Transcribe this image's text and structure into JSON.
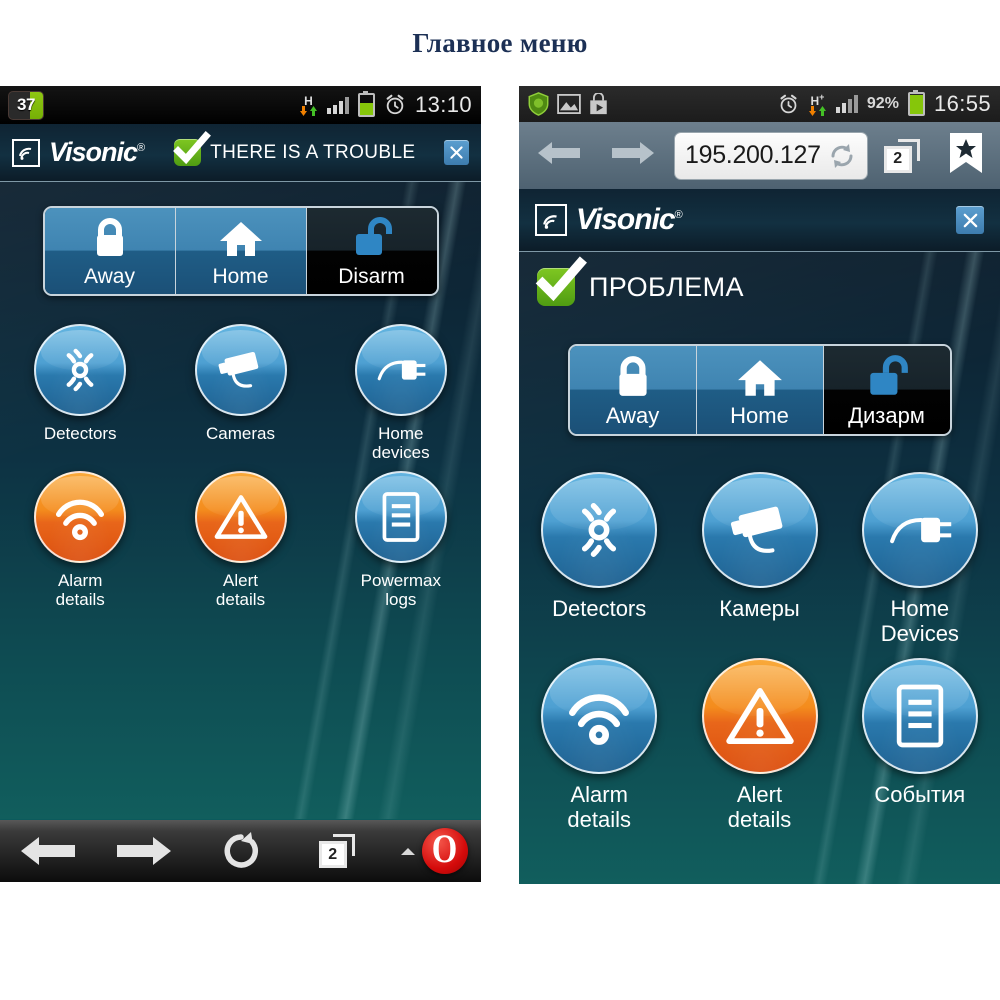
{
  "page": {
    "title": "Главное меню"
  },
  "left_phone": {
    "statusbar": {
      "badge": "37",
      "network_type": "H",
      "network_plus": "",
      "time": "13:10",
      "icons": [
        "calendar-badge-icon",
        "hsdpa-icon",
        "signal-bars-icon",
        "battery-icon",
        "alarm-clock-icon"
      ]
    },
    "app": {
      "brand": "Visonic",
      "brand_reg": "®",
      "trouble_text": "THERE IS A TROUBLE",
      "close_label": "×",
      "modes": [
        {
          "label": "Away",
          "icon": "padlock-closed-icon",
          "active": false
        },
        {
          "label": "Home",
          "icon": "house-icon",
          "active": false
        },
        {
          "label": "Disarm",
          "icon": "padlock-open-icon",
          "active": true
        }
      ],
      "tiles": [
        {
          "label": "Detectors",
          "icon": "motion-detector-icon",
          "color": "blue"
        },
        {
          "label": "Cameras",
          "icon": "cctv-camera-icon",
          "color": "blue"
        },
        {
          "label": "Home\ndevices",
          "icon": "power-plug-icon",
          "color": "blue"
        },
        {
          "label": "Alarm\ndetails",
          "icon": "siren-waves-icon",
          "color": "orange"
        },
        {
          "label": "Alert\ndetails",
          "icon": "warning-triangle-icon",
          "color": "orange"
        },
        {
          "label": "Powermax\nlogs",
          "icon": "document-lines-icon",
          "color": "blue"
        }
      ]
    },
    "bottom_bar": {
      "tab_count": "2",
      "buttons": [
        "back-arrow-icon",
        "forward-arrow-icon",
        "reload-icon",
        "tabs-icon",
        "chevron-up-icon",
        "opera-logo-icon"
      ]
    }
  },
  "right_phone": {
    "statusbar": {
      "time": "16:55",
      "battery_percent": "92%",
      "network_type": "H",
      "network_plus": "+",
      "icons": [
        "drweb-shield-icon",
        "gallery-icon",
        "play-store-icon",
        "alarm-clock-icon",
        "hsdpa-icon",
        "signal-bars-icon",
        "battery-icon"
      ]
    },
    "browser": {
      "url": "195.200.127",
      "tab_count": "2",
      "buttons": [
        "back-arrow-icon",
        "forward-arrow-icon",
        "reload-icon",
        "tabs-icon",
        "bookmark-star-icon"
      ]
    },
    "app": {
      "brand": "Visonic",
      "brand_reg": "®",
      "trouble_text": "ПРОБЛЕМА",
      "close_label": "×",
      "modes": [
        {
          "label": "Away",
          "icon": "padlock-closed-icon",
          "active": false
        },
        {
          "label": "Home",
          "icon": "house-icon",
          "active": false
        },
        {
          "label": "Дизарм",
          "icon": "padlock-open-icon",
          "active": true
        }
      ],
      "tiles": [
        {
          "label": "Detectors",
          "icon": "motion-detector-icon",
          "color": "blue"
        },
        {
          "label": "Камеры",
          "icon": "cctv-camera-icon",
          "color": "blue"
        },
        {
          "label": "Home\nDevices",
          "icon": "power-plug-icon",
          "color": "blue"
        },
        {
          "label": "Alarm\ndetails",
          "icon": "siren-waves-icon",
          "color": "blue"
        },
        {
          "label": "Alert\ndetails",
          "icon": "warning-triangle-icon",
          "color": "orange"
        },
        {
          "label": "События",
          "icon": "document-lines-icon",
          "color": "blue"
        }
      ]
    }
  },
  "colors": {
    "title": "#1c3055",
    "accent_blue": "#3f84b1",
    "accent_orange": "#f48c1d",
    "ok_green": "#6ab41a",
    "opera_red": "#d40a0a"
  }
}
